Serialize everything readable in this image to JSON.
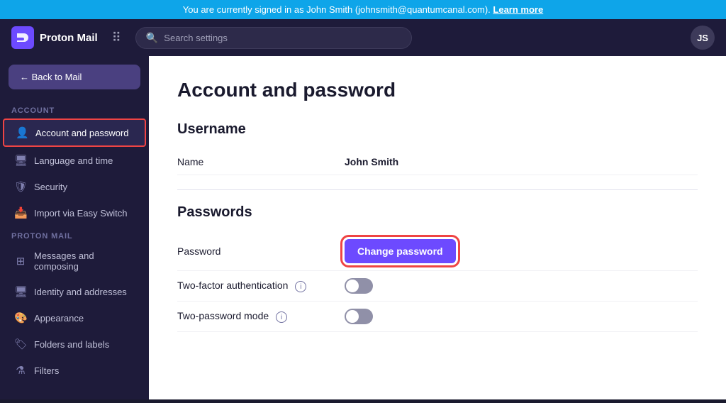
{
  "announcement": {
    "text": "You are currently signed in as John Smith (johnsmith@quantumcanal.com).",
    "link_text": "Learn more"
  },
  "header": {
    "logo_text": "Proton Mail",
    "search_placeholder": "Search settings",
    "avatar_initials": "JS"
  },
  "sidebar": {
    "back_label": "← Back to Mail",
    "sections": [
      {
        "label": "ACCOUNT",
        "items": [
          {
            "id": "account-password",
            "label": "Account and password",
            "icon": "👤",
            "active": true
          },
          {
            "id": "language-time",
            "label": "Language and time",
            "icon": "🖥"
          },
          {
            "id": "security",
            "label": "Security",
            "icon": "🛡"
          },
          {
            "id": "easy-switch",
            "label": "Import via Easy Switch",
            "icon": "📥"
          }
        ]
      },
      {
        "label": "PROTON MAIL",
        "items": [
          {
            "id": "messages-composing",
            "label": "Messages and composing",
            "icon": "⊞"
          },
          {
            "id": "identity-addresses",
            "label": "Identity and addresses",
            "icon": "🖥"
          },
          {
            "id": "appearance",
            "label": "Appearance",
            "icon": "🎨"
          },
          {
            "id": "folders-labels",
            "label": "Folders and labels",
            "icon": "🏷"
          },
          {
            "id": "filters",
            "label": "Filters",
            "icon": "⚗"
          }
        ]
      }
    ]
  },
  "main": {
    "page_title": "Account and password",
    "sections": [
      {
        "id": "username",
        "title": "Username",
        "rows": [
          {
            "label": "Name",
            "value": "John Smith",
            "type": "text"
          }
        ]
      },
      {
        "id": "passwords",
        "title": "Passwords",
        "rows": [
          {
            "label": "Password",
            "type": "button",
            "button_label": "Change password"
          },
          {
            "label": "Two-factor authentication",
            "type": "toggle",
            "has_info": true,
            "enabled": false
          },
          {
            "label": "Two-password mode",
            "type": "toggle",
            "has_info": true,
            "enabled": false
          }
        ]
      }
    ]
  }
}
